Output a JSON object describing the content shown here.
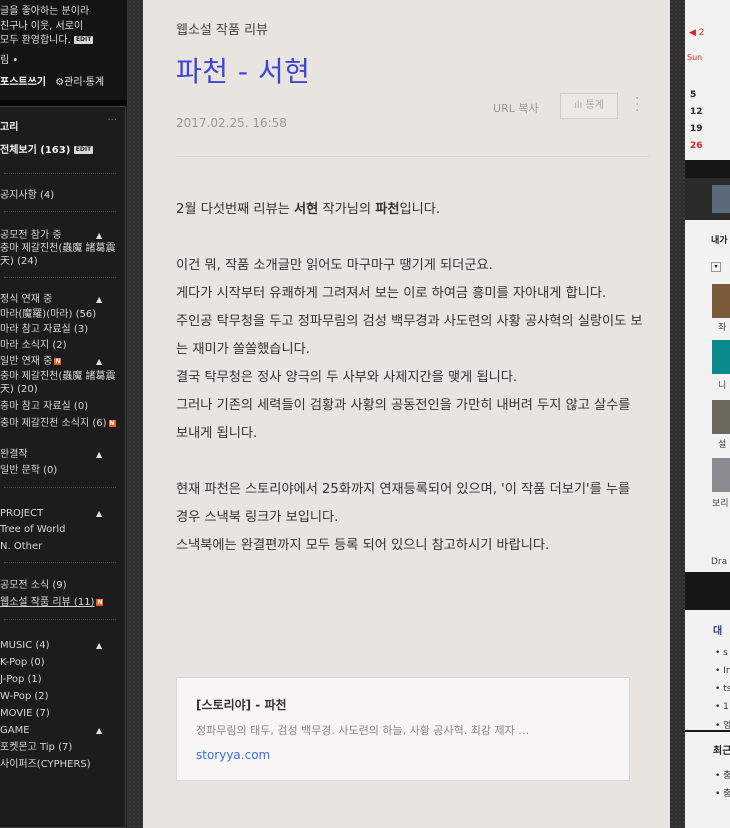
{
  "left_sidebar": {
    "intro_lines": [
      "글을 좋아하는 분이라",
      "친구나 이웃, 서로이",
      "모두 환영합니다."
    ],
    "edit_label": "EDIT",
    "bullet_line": "림 •",
    "write_label": "포스트쓰기",
    "admin_label": "관리·통계",
    "panel_title": "고리",
    "panel_dots": "···",
    "categories": [
      "전체보기 (163)",
      "공지사항 (4)",
      "공모전 참가 중",
      "충마 제갈진천(蟲魔 諸葛震天) (24)",
      "정식 연재 중",
      "마라(魔羅)(마라) (56)",
      "마라 참고 자료실 (3)",
      "마라 소식지 (2)",
      "일반 연재 중",
      "충마 제갈진천(蟲魔 諸葛震天) (20)",
      "충마 참고 자료실 (0)",
      "충마 제갈진천 소식지 (6)",
      "완결작",
      "일반 문학 (0)",
      "PROJECT",
      "Tree of World",
      "N. Other",
      "공모전 소식 (9)",
      "웹소설 작품 리뷰 (11)",
      "MUSIC (4)",
      "K-Pop (0)",
      "J-Pop (1)",
      "W-Pop (2)",
      "MOVIE (7)",
      "GAME",
      "포켓몬고 Tip (7)",
      "사이퍼즈(CYPHERS)"
    ]
  },
  "post": {
    "category": "웹소설 작품 리뷰",
    "title": "파천 - 서현",
    "date": "2017.02.25. 16:58",
    "url_copy_label": "URL 복사",
    "stats_label": "통계",
    "stats_icon": "bar-chart-icon",
    "more_icon": "vertical-dots-icon",
    "body": {
      "p1_pre": "2월 다섯번째 리뷰는 ",
      "p1_author": "서현",
      "p1_mid": " 작가님의 ",
      "p1_work": "파천",
      "p1_post": "입니다.",
      "p2_1": "이건 뭐, 작품 소개글만 읽어도 마구마구 땡기게 되더군요.",
      "p2_2": "게다가 시작부터 유쾌하게 그려져서 보는 이로 하여금 흥미를 자아내게 합니다.",
      "p2_3": "주인공 탁무청을 두고 정파무림의 검성 백무경과 사도련의 사황 공사혁의 실랑이도 보는 재미가 쏠쏠했습니다.",
      "p2_4": "결국 탁무청은 정사 양극의 두 사부와 사제지간을 맺게 됩니다.",
      "p2_5": "그러나 기존의 세력들이 검황과 사황의 공동전인을 가만히 내버려 두지 않고 살수를 보내게 됩니다.",
      "p3_1": "현재 파천은 스토리야에서 25화까지 연재등록되어 있으며, '이 작품 더보기'를 누를 경우 스낵북 링크가 보입니다.",
      "p3_2": "스낵북에는 완결편까지 모두 등록 되어 있으니 참고하시기 바랍니다."
    },
    "link_card": {
      "title": "[스토리야] - 파천",
      "description": "정파무림의 태두, 검성 백무경. 사도련의 하늘, 사황 공사혁. 최강 제자 …",
      "url": "storyya.com"
    }
  },
  "right_sidebar": {
    "cal_arrow": "◀ 2",
    "cal_sun": "Sun",
    "cal_rows": [
      "5",
      "12",
      "19",
      "26"
    ],
    "profile_label": "내가",
    "list_caption_1": "좌",
    "list_caption_2": "니",
    "list_caption_3": "설",
    "list_caption_4": "보리",
    "dra_label": "Dra",
    "section_head_1": "대",
    "section_items_1": [
      "• s",
      "• In",
      "• ts",
      "• 1",
      "• 엉"
    ],
    "section_head_2": "최근",
    "section_items_2": [
      "• 충",
      "• 충"
    ]
  }
}
